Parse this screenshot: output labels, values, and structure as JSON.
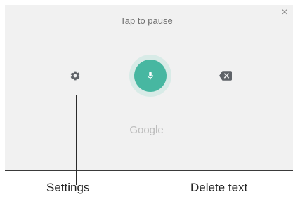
{
  "voice_input": {
    "status_text": "Tap to pause",
    "brand_text": "Google",
    "accent_color": "#47b7a1",
    "icons": {
      "close": "close-icon",
      "settings": "gear-icon",
      "microphone": "microphone-icon",
      "delete": "backspace-icon"
    }
  },
  "callouts": {
    "settings_label": "Settings",
    "delete_label": "Delete text"
  }
}
